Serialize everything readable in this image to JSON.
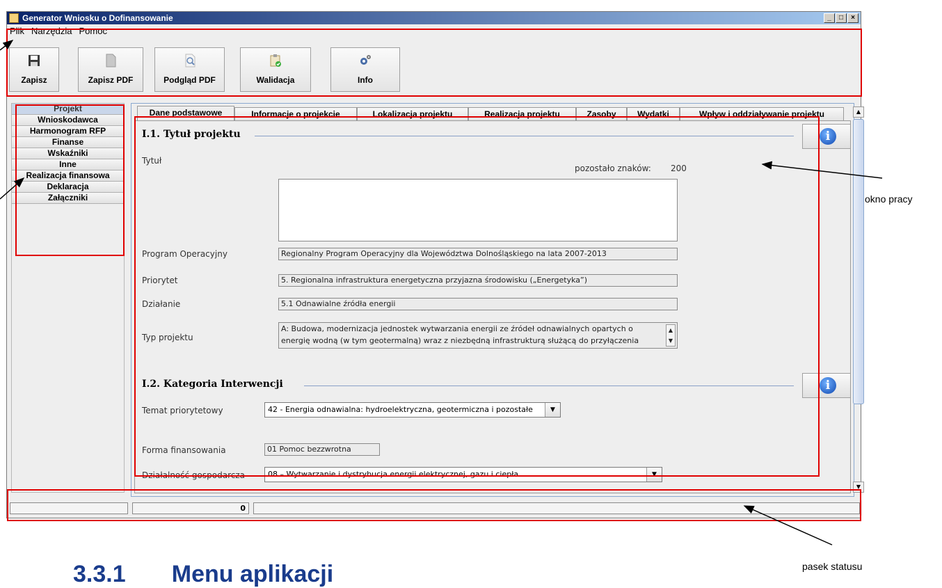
{
  "window": {
    "title": "Generator Wniosku o Dofinansowanie"
  },
  "menu": [
    "Plik",
    "Narzędzia",
    "Pomoc"
  ],
  "toolbar": [
    {
      "label": "Zapisz",
      "icon": "floppy-disk-icon"
    },
    {
      "label": "Zapisz PDF",
      "icon": "pdf-document-icon"
    },
    {
      "label": "Podgląd PDF",
      "icon": "magnifier-document-icon"
    },
    {
      "label": "Walidacja",
      "icon": "clipboard-check-icon"
    },
    {
      "label": "Info",
      "icon": "gears-icon"
    }
  ],
  "sidebar": {
    "items": [
      {
        "label": "Projekt",
        "selected": true
      },
      {
        "label": "Wnioskodawca"
      },
      {
        "label": "Harmonogram RFP"
      },
      {
        "label": "Finanse"
      },
      {
        "label": "Wskaźniki"
      },
      {
        "label": "Inne"
      },
      {
        "label": "Realizacja finansowa"
      },
      {
        "label": "Deklaracja"
      },
      {
        "label": "Załączniki"
      }
    ]
  },
  "tabs": [
    {
      "label": "Dane podstawowe",
      "selected": true
    },
    {
      "label": "Informacje o projekcie"
    },
    {
      "label": "Lokalizacja projektu"
    },
    {
      "label": "Realizacja projektu"
    },
    {
      "label": "Zasoby"
    },
    {
      "label": "Wydatki"
    },
    {
      "label": "Wpływ i oddziaływanie projektu"
    }
  ],
  "section1": {
    "heading": "I.1. Tytuł projektu",
    "title_label": "Tytuł",
    "remaining_label": "pozostało znaków:",
    "remaining_count": "200",
    "title_value": "",
    "program_label": "Program Operacyjny",
    "program_value": "Regionalny Program Operacyjny dla Województwa Dolnośląskiego na lata 2007-2013",
    "priority_label": "Priorytet",
    "priority_value": "5. Regionalna infrastruktura energetyczna przyjazna środowisku („Energetyka”)",
    "action_label": "Działanie",
    "action_value": "5.1 Odnawialne źródła energii",
    "type_label": "Typ projektu",
    "type_value_line1": "A: Budowa, modernizacja jednostek wytwarzania energii ze źródeł odnawialnych opartych o",
    "type_value_line2": "energię wodną (w tym geotermalną) wraz z niezbędną infrastrukturą służącą do przyłączenia"
  },
  "section2": {
    "heading": "I.2. Kategoria Interwencji",
    "topic_label": "Temat priorytetowy",
    "topic_value": "42 - Energia odnawialna: hydroelektryczna, geotermiczna i pozostałe",
    "financing_label": "Forma finansowania",
    "financing_value": "01 Pomoc bezzwrotna",
    "business_label": "Działalność gospodarcza",
    "business_value": "08 – Wytwarzanie i dystrybucja energii elektrycznej, gazu i ciepła"
  },
  "statusbar": {
    "cell1": "",
    "cell2": "0",
    "cell3": ""
  },
  "annotations": {
    "work_window": "okno pracy",
    "status_bar": "pasek statusu"
  },
  "document_heading": "3.3.1       Menu aplikacji",
  "colors": {
    "annotation_red": "#e00000",
    "title_bar": "#0a246a",
    "heading_blue": "#1a3c8c"
  }
}
